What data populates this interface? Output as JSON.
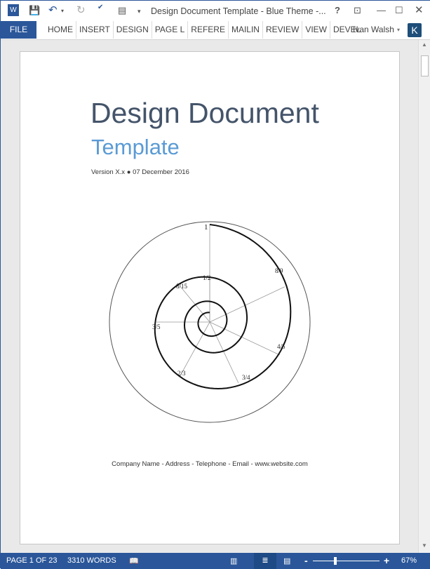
{
  "window": {
    "title": "Design Document Template - Blue Theme -...",
    "app_icon": "word-icon"
  },
  "ribbon": {
    "file": "FILE",
    "tabs": [
      "HOME",
      "INSERT",
      "DESIGN",
      "PAGE L",
      "REFERE",
      "MAILIN",
      "REVIEW",
      "VIEW",
      "DEVEL"
    ],
    "user": "Ivan Walsh",
    "avatar": "K"
  },
  "document": {
    "title": "Design Document",
    "subtitle": "Template",
    "version_line": "Version X.x ● 07 December 2016",
    "footer": "Company Name - Address - Telephone - Email - www.website.com",
    "figure_labels": [
      "1",
      "8/9",
      "4/5",
      "3/4",
      "2/3",
      "3/5",
      "8/15",
      "1/2"
    ]
  },
  "status": {
    "page": "PAGE 1 OF 23",
    "words": "3310 WORDS",
    "zoom": "67%",
    "zoom_minus": "-",
    "zoom_plus": "+"
  },
  "colors": {
    "accent": "#2b579a",
    "title": "#44546a",
    "subtitle": "#5b9bd5"
  }
}
